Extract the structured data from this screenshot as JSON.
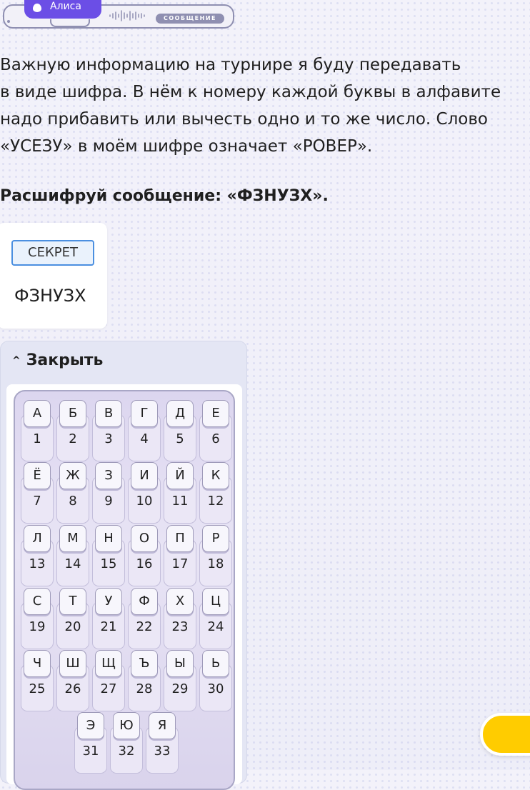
{
  "banner": {
    "name": "Алиса",
    "badge": "СООБЩЕНИЕ"
  },
  "intro_lines": [
    "Важную информацию на турнире я буду передавать",
    "в виде шифра. В нём к номеру каждой буквы в алфавите",
    "надо прибавить или вычесть одно и то же число. Слово",
    "«УСЕЗУ» в моём шифре означает «РОВЕР»."
  ],
  "task": "Расшифруй сообщение: «ФЗНУЗХ».",
  "secret": {
    "label": "СЕКРЕТ",
    "word": "ФЗНУЗХ"
  },
  "panel": {
    "close_label": "Закрыть"
  },
  "alphabet": [
    {
      "letter": "А",
      "num": "1"
    },
    {
      "letter": "Б",
      "num": "2"
    },
    {
      "letter": "В",
      "num": "3"
    },
    {
      "letter": "Г",
      "num": "4"
    },
    {
      "letter": "Д",
      "num": "5"
    },
    {
      "letter": "Е",
      "num": "6"
    },
    {
      "letter": "Ё",
      "num": "7"
    },
    {
      "letter": "Ж",
      "num": "8"
    },
    {
      "letter": "З",
      "num": "9"
    },
    {
      "letter": "И",
      "num": "10"
    },
    {
      "letter": "Й",
      "num": "11"
    },
    {
      "letter": "К",
      "num": "12"
    },
    {
      "letter": "Л",
      "num": "13"
    },
    {
      "letter": "М",
      "num": "14"
    },
    {
      "letter": "Н",
      "num": "15"
    },
    {
      "letter": "О",
      "num": "16"
    },
    {
      "letter": "П",
      "num": "17"
    },
    {
      "letter": "Р",
      "num": "18"
    },
    {
      "letter": "С",
      "num": "19"
    },
    {
      "letter": "Т",
      "num": "20"
    },
    {
      "letter": "У",
      "num": "21"
    },
    {
      "letter": "Ф",
      "num": "22"
    },
    {
      "letter": "Х",
      "num": "23"
    },
    {
      "letter": "Ц",
      "num": "24"
    },
    {
      "letter": "Ч",
      "num": "25"
    },
    {
      "letter": "Ш",
      "num": "26"
    },
    {
      "letter": "Щ",
      "num": "27"
    },
    {
      "letter": "Ъ",
      "num": "28"
    },
    {
      "letter": "Ы",
      "num": "29"
    },
    {
      "letter": "Ь",
      "num": "30"
    },
    {
      "letter": "Э",
      "num": "31"
    },
    {
      "letter": "Ю",
      "num": "32"
    },
    {
      "letter": "Я",
      "num": "33"
    }
  ],
  "colors": {
    "accent": "#6b4ee6",
    "action": "#ffcc00",
    "secret_border": "#4b8fe0"
  }
}
